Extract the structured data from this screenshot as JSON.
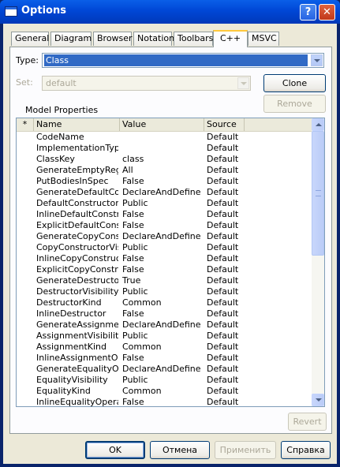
{
  "window": {
    "title": "Options"
  },
  "tabs": [
    {
      "label": "General"
    },
    {
      "label": "Diagram"
    },
    {
      "label": "Browser"
    },
    {
      "label": "Notation"
    },
    {
      "label": "Toolbars"
    },
    {
      "label": "C++"
    },
    {
      "label": "MSVC"
    }
  ],
  "active_tab": "C++",
  "form": {
    "type_label": "Type:",
    "type_value": "Class",
    "set_label": "Set:",
    "set_value": "default",
    "clone_label": "Clone",
    "remove_label": "Remove",
    "model_properties_label": "Model Properties",
    "revert_label": "Revert"
  },
  "grid": {
    "columns": [
      "*",
      "Name",
      "Value",
      "Source"
    ],
    "rows": [
      {
        "name": "CodeName",
        "value": "",
        "source": "Default"
      },
      {
        "name": "ImplementationType",
        "value": "",
        "source": "Default"
      },
      {
        "name": "ClassKey",
        "value": "class",
        "source": "Default"
      },
      {
        "name": "GenerateEmptyRegion",
        "value": "All",
        "source": "Default"
      },
      {
        "name": "PutBodiesInSpec",
        "value": "False",
        "source": "Default"
      },
      {
        "name": "GenerateDefaultConstructor",
        "value": "DeclareAndDefine",
        "source": "Default"
      },
      {
        "name": "DefaultConstructorVisibility",
        "value": "Public",
        "source": "Default"
      },
      {
        "name": "InlineDefaultConstructor",
        "value": "False",
        "source": "Default"
      },
      {
        "name": "ExplicitDefaultConstructor",
        "value": "False",
        "source": "Default"
      },
      {
        "name": "GenerateCopyConstructor",
        "value": "DeclareAndDefine",
        "source": "Default"
      },
      {
        "name": "CopyConstructorVisibility",
        "value": "Public",
        "source": "Default"
      },
      {
        "name": "InlineCopyConstructor",
        "value": "False",
        "source": "Default"
      },
      {
        "name": "ExplicitCopyConstructor",
        "value": "False",
        "source": "Default"
      },
      {
        "name": "GenerateDestructor",
        "value": "True",
        "source": "Default"
      },
      {
        "name": "DestructorVisibility",
        "value": "Public",
        "source": "Default"
      },
      {
        "name": "DestructorKind",
        "value": "Common",
        "source": "Default"
      },
      {
        "name": "InlineDestructor",
        "value": "False",
        "source": "Default"
      },
      {
        "name": "GenerateAssignmentOperation",
        "value": "DeclareAndDefine",
        "source": "Default"
      },
      {
        "name": "AssignmentVisibility",
        "value": "Public",
        "source": "Default"
      },
      {
        "name": "AssignmentKind",
        "value": "Common",
        "source": "Default"
      },
      {
        "name": "InlineAssignmentOperation",
        "value": "False",
        "source": "Default"
      },
      {
        "name": "GenerateEqualityOperations",
        "value": "DeclareAndDefine",
        "source": "Default"
      },
      {
        "name": "EqualityVisibility",
        "value": "Public",
        "source": "Default"
      },
      {
        "name": "EqualityKind",
        "value": "Common",
        "source": "Default"
      },
      {
        "name": "InlineEqualityOperations",
        "value": "False",
        "source": "Default"
      }
    ]
  },
  "footer": {
    "ok": "OK",
    "cancel": "Отмена",
    "apply": "Применить",
    "help": "Справка"
  }
}
